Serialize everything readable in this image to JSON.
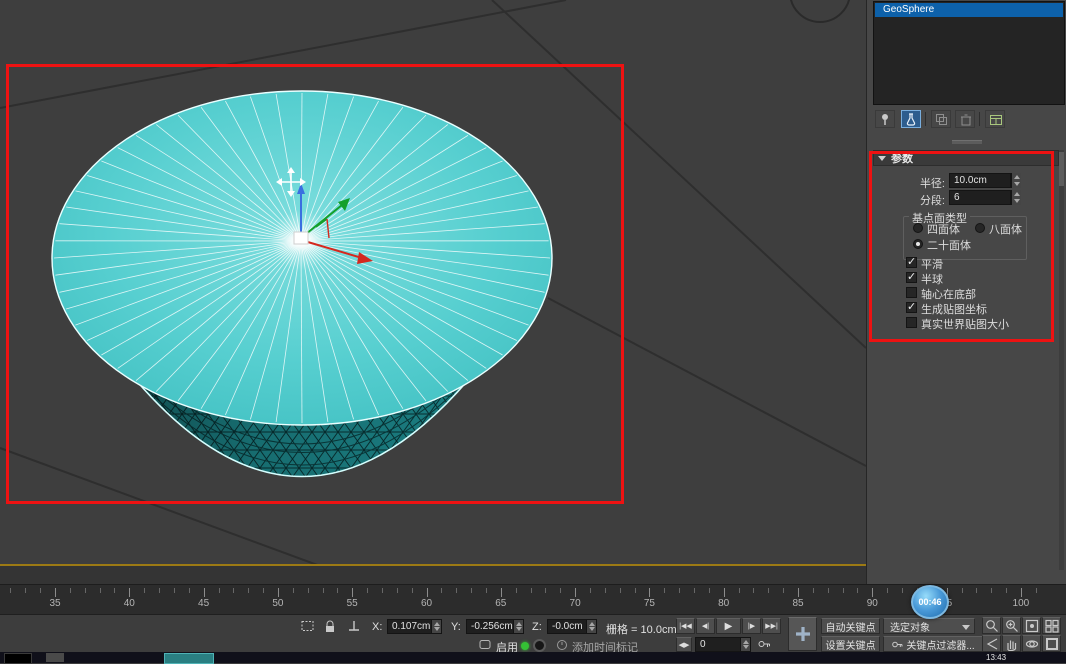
{
  "colors": {
    "annotation_red": "#ee1212",
    "selection_blue": "#0d61aa",
    "object_teal": "#57cfd0",
    "slider_blue": "#4a9ad8"
  },
  "modifier_stack": {
    "selected_item": "GeoSphere"
  },
  "parameters": {
    "rollout_title": "参数",
    "radius_label": "半径:",
    "radius_value": "10.0cm",
    "segments_label": "分段:",
    "segments_value": "6",
    "base_type_label": "基点面类型",
    "radio_tetra": "四面体",
    "radio_octa": "八面体",
    "radio_icosa": "二十面体",
    "radio_selected": "二十面体",
    "check_smooth": "平滑",
    "check_hemisphere": "半球",
    "check_base_pivot": "轴心在底部",
    "check_mapping": "生成贴图坐标",
    "check_realworld": "真实世界贴图大小",
    "checked_items": [
      "平滑",
      "半球",
      "生成贴图坐标"
    ]
  },
  "timeline": {
    "labels": [
      "35",
      "40",
      "45",
      "50",
      "55",
      "60",
      "65",
      "70",
      "75",
      "80",
      "85",
      "90",
      "95",
      "100"
    ],
    "slider_value": "00:46"
  },
  "playback": {
    "go_start": "|◀◀",
    "prev": "◀|",
    "play": "▶",
    "next": "|▶",
    "go_end": "▶▶|"
  },
  "status": {
    "x_label": "X:",
    "x_value": "0.107cm",
    "y_label": "Y:",
    "y_value": "-0.256cm",
    "z_label": "Z:",
    "z_value": "-0.0cm",
    "grid_text": "栅格 = 10.0cm",
    "enable_label": "启用",
    "add_time_tag": "添加时间标记",
    "frame_value": "0",
    "auto_key": "自动关键点",
    "selection_set": "选定对象",
    "set_key": "设置关键点",
    "key_filters": "关键点过滤器..."
  },
  "taskbar": {
    "clock": "13:43"
  }
}
